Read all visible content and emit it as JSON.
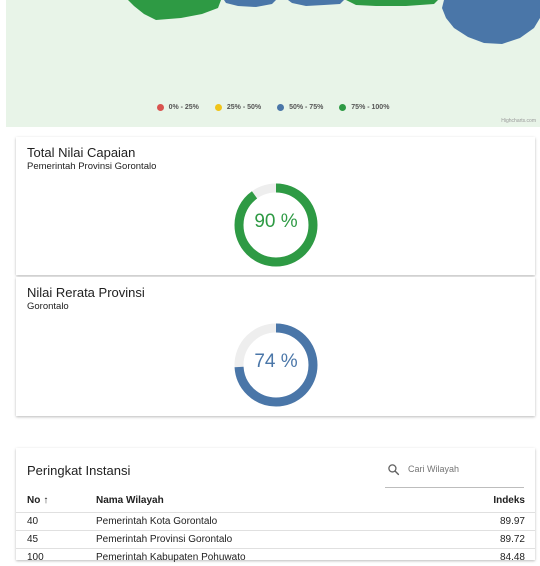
{
  "map": {
    "legend": [
      {
        "label": "0% - 25%",
        "color": "#d9534f"
      },
      {
        "label": "25% - 50%",
        "color": "#f0c419"
      },
      {
        "label": "50% - 75%",
        "color": "#4a76a8"
      },
      {
        "label": "75% - 100%",
        "color": "#2e9a44"
      }
    ],
    "credits": "Highcharts.com"
  },
  "total_card": {
    "title": "Total Nilai Capaian",
    "subtitle": "Pemerintah Provinsi Gorontalo",
    "value": 90,
    "value_label": "90 %",
    "color": "#2e9a44"
  },
  "avg_card": {
    "title": "Nilai Rerata Provinsi",
    "subtitle": "Gorontalo",
    "value": 74,
    "value_label": "74 %",
    "color": "#4a76a8"
  },
  "ranking": {
    "title": "Peringkat Instansi",
    "search_placeholder": "Cari Wilayah",
    "columns": {
      "no": "No",
      "name": "Nama Wilayah",
      "index": "Indeks"
    },
    "rows": [
      {
        "no": "40",
        "name": "Pemerintah Kota Gorontalo",
        "index": "89.97"
      },
      {
        "no": "45",
        "name": "Pemerintah Provinsi Gorontalo",
        "index": "89.72"
      },
      {
        "no": "100",
        "name": "Pemerintah Kabupaten Pohuwato",
        "index": "84.48"
      }
    ]
  }
}
